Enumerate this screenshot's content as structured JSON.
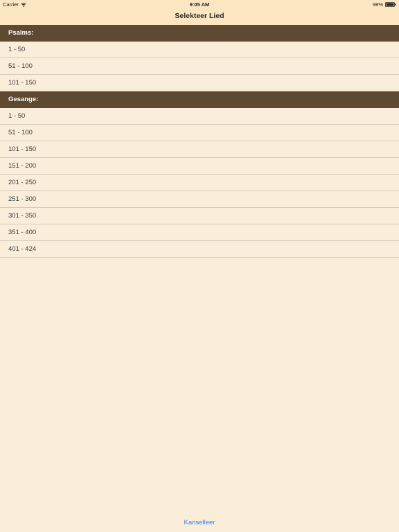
{
  "status_bar": {
    "carrier": "Carrier",
    "time": "9:05 AM",
    "battery": "98%"
  },
  "nav": {
    "title": "Selekteer Lied"
  },
  "sections": [
    {
      "header": "Psalms:",
      "items": [
        "1 - 50",
        "51 - 100",
        "101 - 150"
      ]
    },
    {
      "header": "Gesange:",
      "items": [
        "1 - 50",
        "51 - 100",
        "101 - 150",
        "151 - 200",
        "201 - 250",
        "251 - 300",
        "301 - 350",
        "351 - 400",
        "401 - 424"
      ]
    }
  ],
  "footer": {
    "cancel_label": "Kanselleer"
  },
  "colors": {
    "background": "#faeedb",
    "bar": "#fbe6c1",
    "section_header": "#5e4a32",
    "link": "#2f7fe6"
  }
}
